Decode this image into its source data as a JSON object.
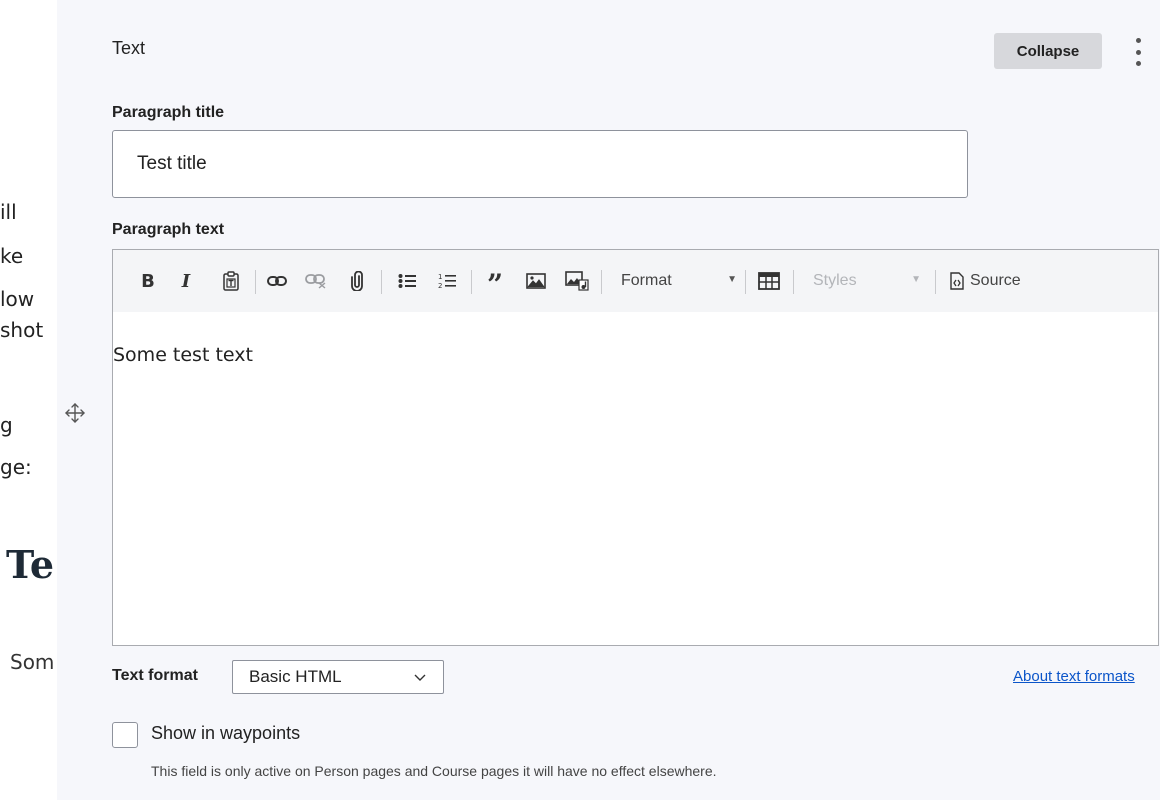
{
  "background_text": {
    "lines": [
      "ill",
      "ke",
      "low",
      "shot",
      "g",
      "ge:"
    ],
    "heading": "Te",
    "body": "Som"
  },
  "paragraph": {
    "type_label": "Text",
    "collapse_label": "Collapse",
    "menu_icon": "kebab-menu-icon",
    "drag_icon": "move-handle-icon"
  },
  "title_field": {
    "label": "Paragraph title",
    "value": "Test title"
  },
  "text_field": {
    "label": "Paragraph text",
    "content": "Some test text"
  },
  "toolbar": {
    "buttons": [
      "bold-icon",
      "italic-icon",
      "paste-text-icon",
      "link-icon",
      "unlink-icon",
      "attachment-icon",
      "bulleted-list-icon",
      "numbered-list-icon",
      "blockquote-icon",
      "image-icon",
      "media-icon",
      "table-icon",
      "source-icon"
    ],
    "format_label": "Format",
    "styles_label": "Styles",
    "source_label": "Source"
  },
  "text_format": {
    "label": "Text format",
    "selected": "Basic HTML",
    "about_link": "About text formats"
  },
  "waypoints": {
    "label": "Show in waypoints",
    "checked": false,
    "help": "This field is only active on Person pages and Course pages it will have no effect elsewhere."
  },
  "colors": {
    "panel_bg": "#f6f7fb",
    "link": "#0b55c9",
    "collapse_bg": "#d7d8dc"
  }
}
